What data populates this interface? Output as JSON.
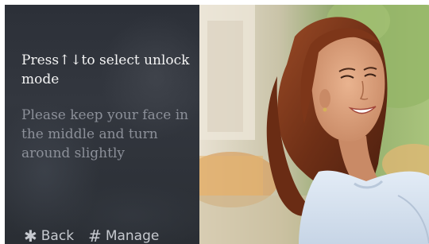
{
  "instructions": {
    "title": "Press↑↓to select unlock mode",
    "hint": "Please keep your face in the middle and turn around slightly"
  },
  "footer": {
    "back": {
      "icon": "asterisk-icon",
      "glyph": "✱",
      "label": "Back"
    },
    "manage": {
      "icon": "hash-icon",
      "glyph": "#",
      "label": "Manage"
    }
  },
  "colors": {
    "panel_background": "#30343b",
    "title_text": "#f4f4f4",
    "hint_text": "#8c9099",
    "footer_text": "#c6c9cf"
  }
}
